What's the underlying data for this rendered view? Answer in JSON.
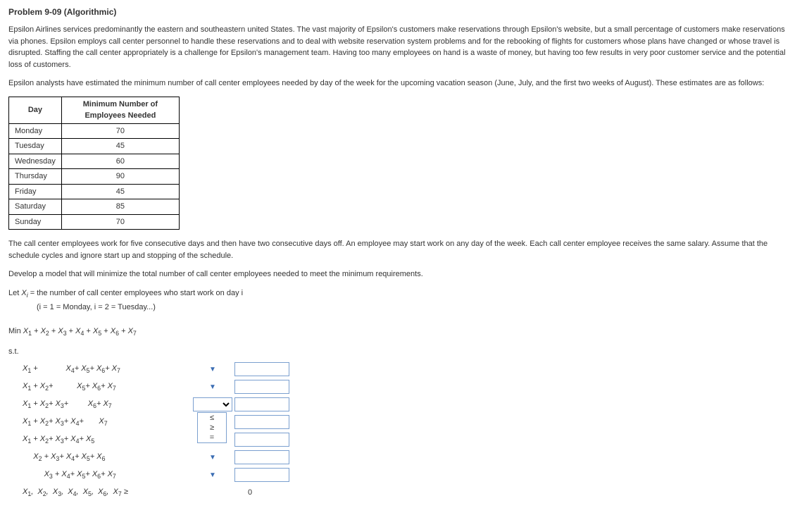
{
  "title": "Problem 9-09 (Algorithmic)",
  "para1": "Epsilon Airlines services predominantly the eastern and southeastern united States. The vast majority of Epsilon's customers make reservations through Epsilon's website, but a small percentage of customers make reservations via phones. Epsilon employs call center personnel to handle these reservations and to deal with website reservation system problems and for the rebooking of flights for customers whose plans have changed or whose travel is disrupted. Staffing the call center appropriately is a challenge for Epsilon's management team. Having too many employees on hand is a waste of money, but having too few results in very poor customer service and the potential loss of customers.",
  "para2": "Epsilon analysts have estimated the minimum number of call center employees needed by day of the week for the upcoming vacation season (June, July, and the first two weeks of August). These estimates are as follows:",
  "table": {
    "h1": "Day",
    "h2": "Minimum Number of Employees Needed",
    "rows": [
      {
        "day": "Monday",
        "val": "70"
      },
      {
        "day": "Tuesday",
        "val": "45"
      },
      {
        "day": "Wednesday",
        "val": "60"
      },
      {
        "day": "Thursday",
        "val": "90"
      },
      {
        "day": "Friday",
        "val": "45"
      },
      {
        "day": "Saturday",
        "val": "85"
      },
      {
        "day": "Sunday",
        "val": "70"
      }
    ]
  },
  "para3": "The call center employees work for five consecutive days and then have two consecutive days off. An employee may start work on any day of the week. Each call center employee receives the same salary. Assume that the schedule cycles and ignore start up and stopping of the schedule.",
  "para4": "Develop a model that will minimize the total number of call center employees needed to meet the minimum requirements.",
  "let_prefix": "Let ",
  "let_var": "X",
  "let_sub": "i",
  "let_eq": " = the number of call center employees who start work on day i",
  "let_note": "(i = 1 = Monday, i = 2 = Tuesday...)",
  "obj_prefix": "Min ",
  "st": "s.t.",
  "nonneg_rhs": "0",
  "ops": {
    "le": "≤",
    "ge": "≥",
    "eq": "="
  }
}
